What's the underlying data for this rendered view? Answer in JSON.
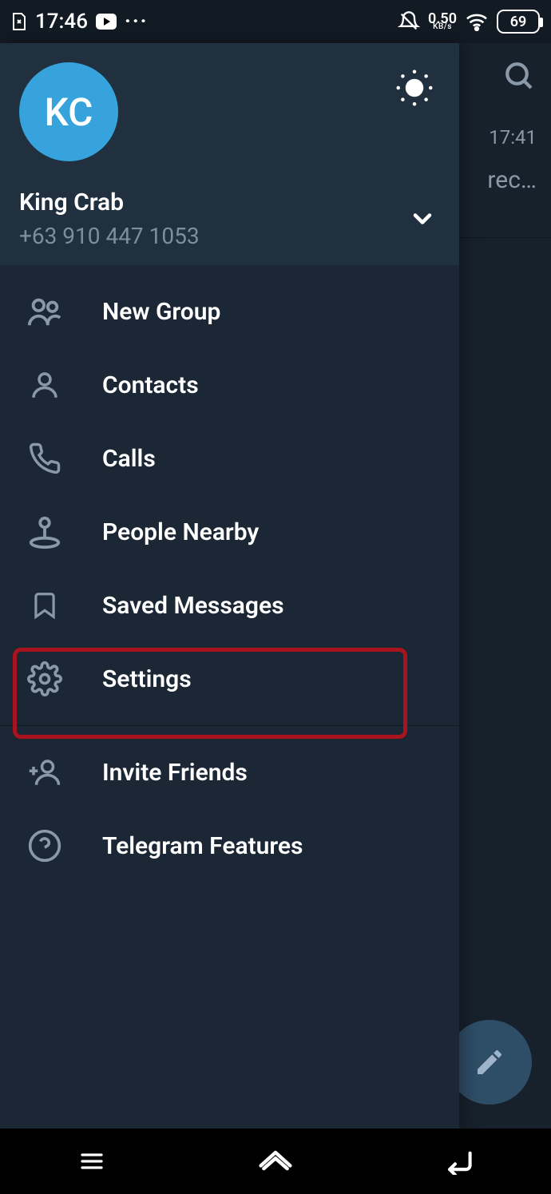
{
  "statusbar": {
    "time": "17:46",
    "net_speed_value": "0.50",
    "net_speed_unit": "KB/s",
    "battery_pct": "69"
  },
  "behind": {
    "chat_time": "17:41",
    "chat_preview": "rec…"
  },
  "drawer": {
    "avatar_initials": "KC",
    "user_name": "King Crab",
    "user_phone": "+63 910 447 1053",
    "menu": {
      "new_group": "New Group",
      "contacts": "Contacts",
      "calls": "Calls",
      "people_nearby": "People Nearby",
      "saved_messages": "Saved Messages",
      "settings": "Settings",
      "invite_friends": "Invite Friends",
      "telegram_features": "Telegram Features"
    }
  }
}
